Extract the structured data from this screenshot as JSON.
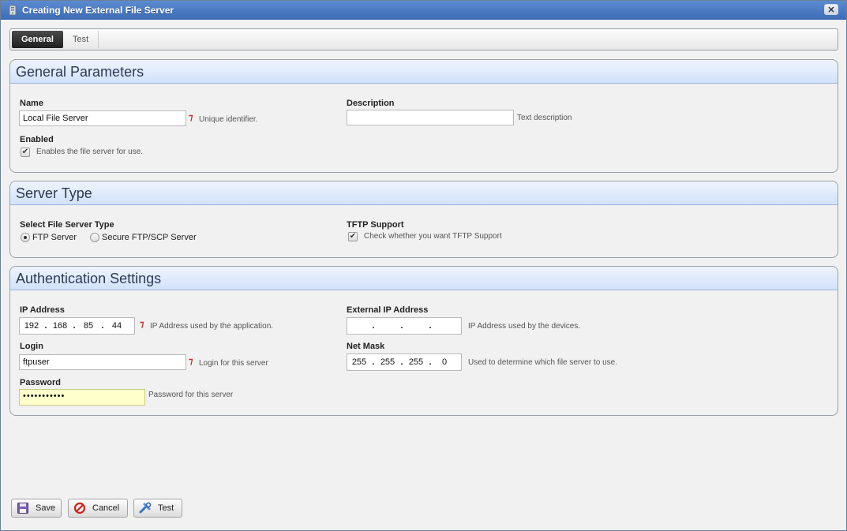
{
  "window": {
    "title": "Creating New External File Server",
    "close_glyph": "✕"
  },
  "tabs": [
    {
      "label": "General",
      "active": true
    },
    {
      "label": "Test",
      "active": false
    }
  ],
  "general": {
    "header": "General Parameters",
    "name_label": "Name",
    "name_value": "Local File Server",
    "name_hint": "Unique identifier.",
    "description_label": "Description",
    "description_value": "",
    "description_hint": "Text description",
    "enabled_label": "Enabled",
    "enabled_checked": true,
    "enabled_hint": "Enables the file server for use."
  },
  "server_type": {
    "header": "Server Type",
    "select_label": "Select File Server Type",
    "options": [
      "FTP Server",
      "Secure FTP/SCP Server"
    ],
    "selected": "FTP Server",
    "tftp_label": "TFTP Support",
    "tftp_checked": true,
    "tftp_hint": "Check whether you want TFTP Support"
  },
  "auth": {
    "header": "Authentication Settings",
    "ip_label": "IP Address",
    "ip_octets": [
      "192",
      "168",
      "85",
      "44"
    ],
    "ip_hint": "IP Address used by the application.",
    "ext_ip_label": "External IP Address",
    "ext_ip_octets": [
      "",
      "",
      "",
      ""
    ],
    "ext_ip_hint": "IP Address used by the devices.",
    "login_label": "Login",
    "login_value": "ftpuser",
    "login_hint": "Login for this server",
    "netmask_label": "Net Mask",
    "netmask_octets": [
      "255",
      "255",
      "255",
      "0"
    ],
    "netmask_hint": "Used to determine which file server to use.",
    "password_label": "Password",
    "password_value": "•••••••••••",
    "password_hint": "Password for this server"
  },
  "buttons": {
    "save": "Save",
    "cancel": "Cancel",
    "test": "Test"
  },
  "colors": {
    "title_bar": "#4a7bc4",
    "section_header": "#d2e2fa",
    "required_marker": "#c0302a",
    "password_bg": "#ffffcc"
  },
  "icons": {
    "app": "server-icon",
    "required": "required-marker-icon",
    "save": "floppy-disk-icon",
    "cancel": "cancel-circle-icon",
    "test": "test-tools-icon"
  }
}
